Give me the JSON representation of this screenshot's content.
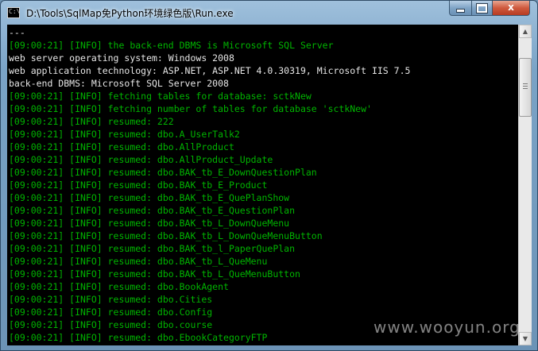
{
  "window": {
    "title": "D:\\Tools\\SqlMap免Python环境绿色版\\Run.exe",
    "icon_text": "C:\\",
    "controls": {
      "minimize_icon": "minimize-icon",
      "maximize_icon": "maximize-icon",
      "close_label": "x"
    }
  },
  "console": {
    "colors": {
      "info": "#00b400",
      "plain": "#e6e6e6",
      "background": "#000000"
    },
    "lines": [
      {
        "text": "---",
        "kind": "plain"
      },
      {
        "text": "[09:00:21] [INFO] the back-end DBMS is Microsoft SQL Server",
        "kind": "info"
      },
      {
        "text": "web server operating system: Windows 2008",
        "kind": "plain"
      },
      {
        "text": "web application technology: ASP.NET, ASP.NET 4.0.30319, Microsoft IIS 7.5",
        "kind": "plain"
      },
      {
        "text": "back-end DBMS: Microsoft SQL Server 2008",
        "kind": "plain"
      },
      {
        "text": "[09:00:21] [INFO] fetching tables for database: sctkNew",
        "kind": "info"
      },
      {
        "text": "[09:00:21] [INFO] fetching number of tables for database 'sctkNew'",
        "kind": "info"
      },
      {
        "text": "[09:00:21] [INFO] resumed: 222",
        "kind": "info"
      },
      {
        "text": "[09:00:21] [INFO] resumed: dbo.A_UserTalk2",
        "kind": "info"
      },
      {
        "text": "[09:00:21] [INFO] resumed: dbo.AllProduct",
        "kind": "info"
      },
      {
        "text": "[09:00:21] [INFO] resumed: dbo.AllProduct_Update",
        "kind": "info"
      },
      {
        "text": "[09:00:21] [INFO] resumed: dbo.BAK_tb_E_DownQuestionPlan",
        "kind": "info"
      },
      {
        "text": "[09:00:21] [INFO] resumed: dbo.BAK_tb_E_Product",
        "kind": "info"
      },
      {
        "text": "[09:00:21] [INFO] resumed: dbo.BAK_tb_E_QuePlanShow",
        "kind": "info"
      },
      {
        "text": "[09:00:21] [INFO] resumed: dbo.BAK_tb_E_QuestionPlan",
        "kind": "info"
      },
      {
        "text": "[09:00:21] [INFO] resumed: dbo.BAK_tb_L_DownQueMenu",
        "kind": "info"
      },
      {
        "text": "[09:00:21] [INFO] resumed: dbo.BAK_tb_L_DownQueMenuButton",
        "kind": "info"
      },
      {
        "text": "[09:00:21] [INFO] resumed: dbo.BAK_tb_l_PaperQuePlan",
        "kind": "info"
      },
      {
        "text": "[09:00:21] [INFO] resumed: dbo.BAK_tb_L_QueMenu",
        "kind": "info"
      },
      {
        "text": "[09:00:21] [INFO] resumed: dbo.BAK_tb_L_QueMenuButton",
        "kind": "info"
      },
      {
        "text": "[09:00:21] [INFO] resumed: dbo.BookAgent",
        "kind": "info"
      },
      {
        "text": "[09:00:21] [INFO] resumed: dbo.Cities",
        "kind": "info"
      },
      {
        "text": "[09:00:21] [INFO] resumed: dbo.Config",
        "kind": "info"
      },
      {
        "text": "[09:00:21] [INFO] resumed: dbo.course",
        "kind": "info"
      },
      {
        "text": "[09:00:21] [INFO] resumed: dbo.EbookCategoryFTP",
        "kind": "info"
      }
    ]
  },
  "scrollbar": {
    "up_icon": "scroll-up-arrow-icon",
    "down_icon": "scroll-down-arrow-icon"
  },
  "watermark": "www.wooyun.org"
}
